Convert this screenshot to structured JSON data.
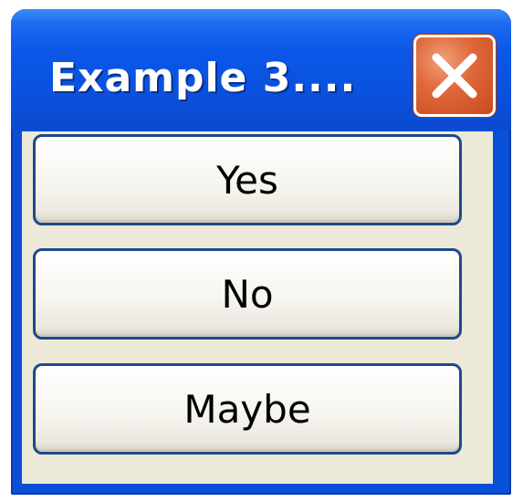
{
  "window": {
    "title": "Example 3....",
    "close_icon": "close-icon"
  },
  "buttons": {
    "yes_label": "Yes",
    "no_label": "No",
    "maybe_label": "Maybe"
  },
  "colors": {
    "titlebar_blue": "#0b57e8",
    "close_red": "#e06a3c",
    "client_bg": "#ece9d8",
    "button_border": "#1d4a8a"
  }
}
